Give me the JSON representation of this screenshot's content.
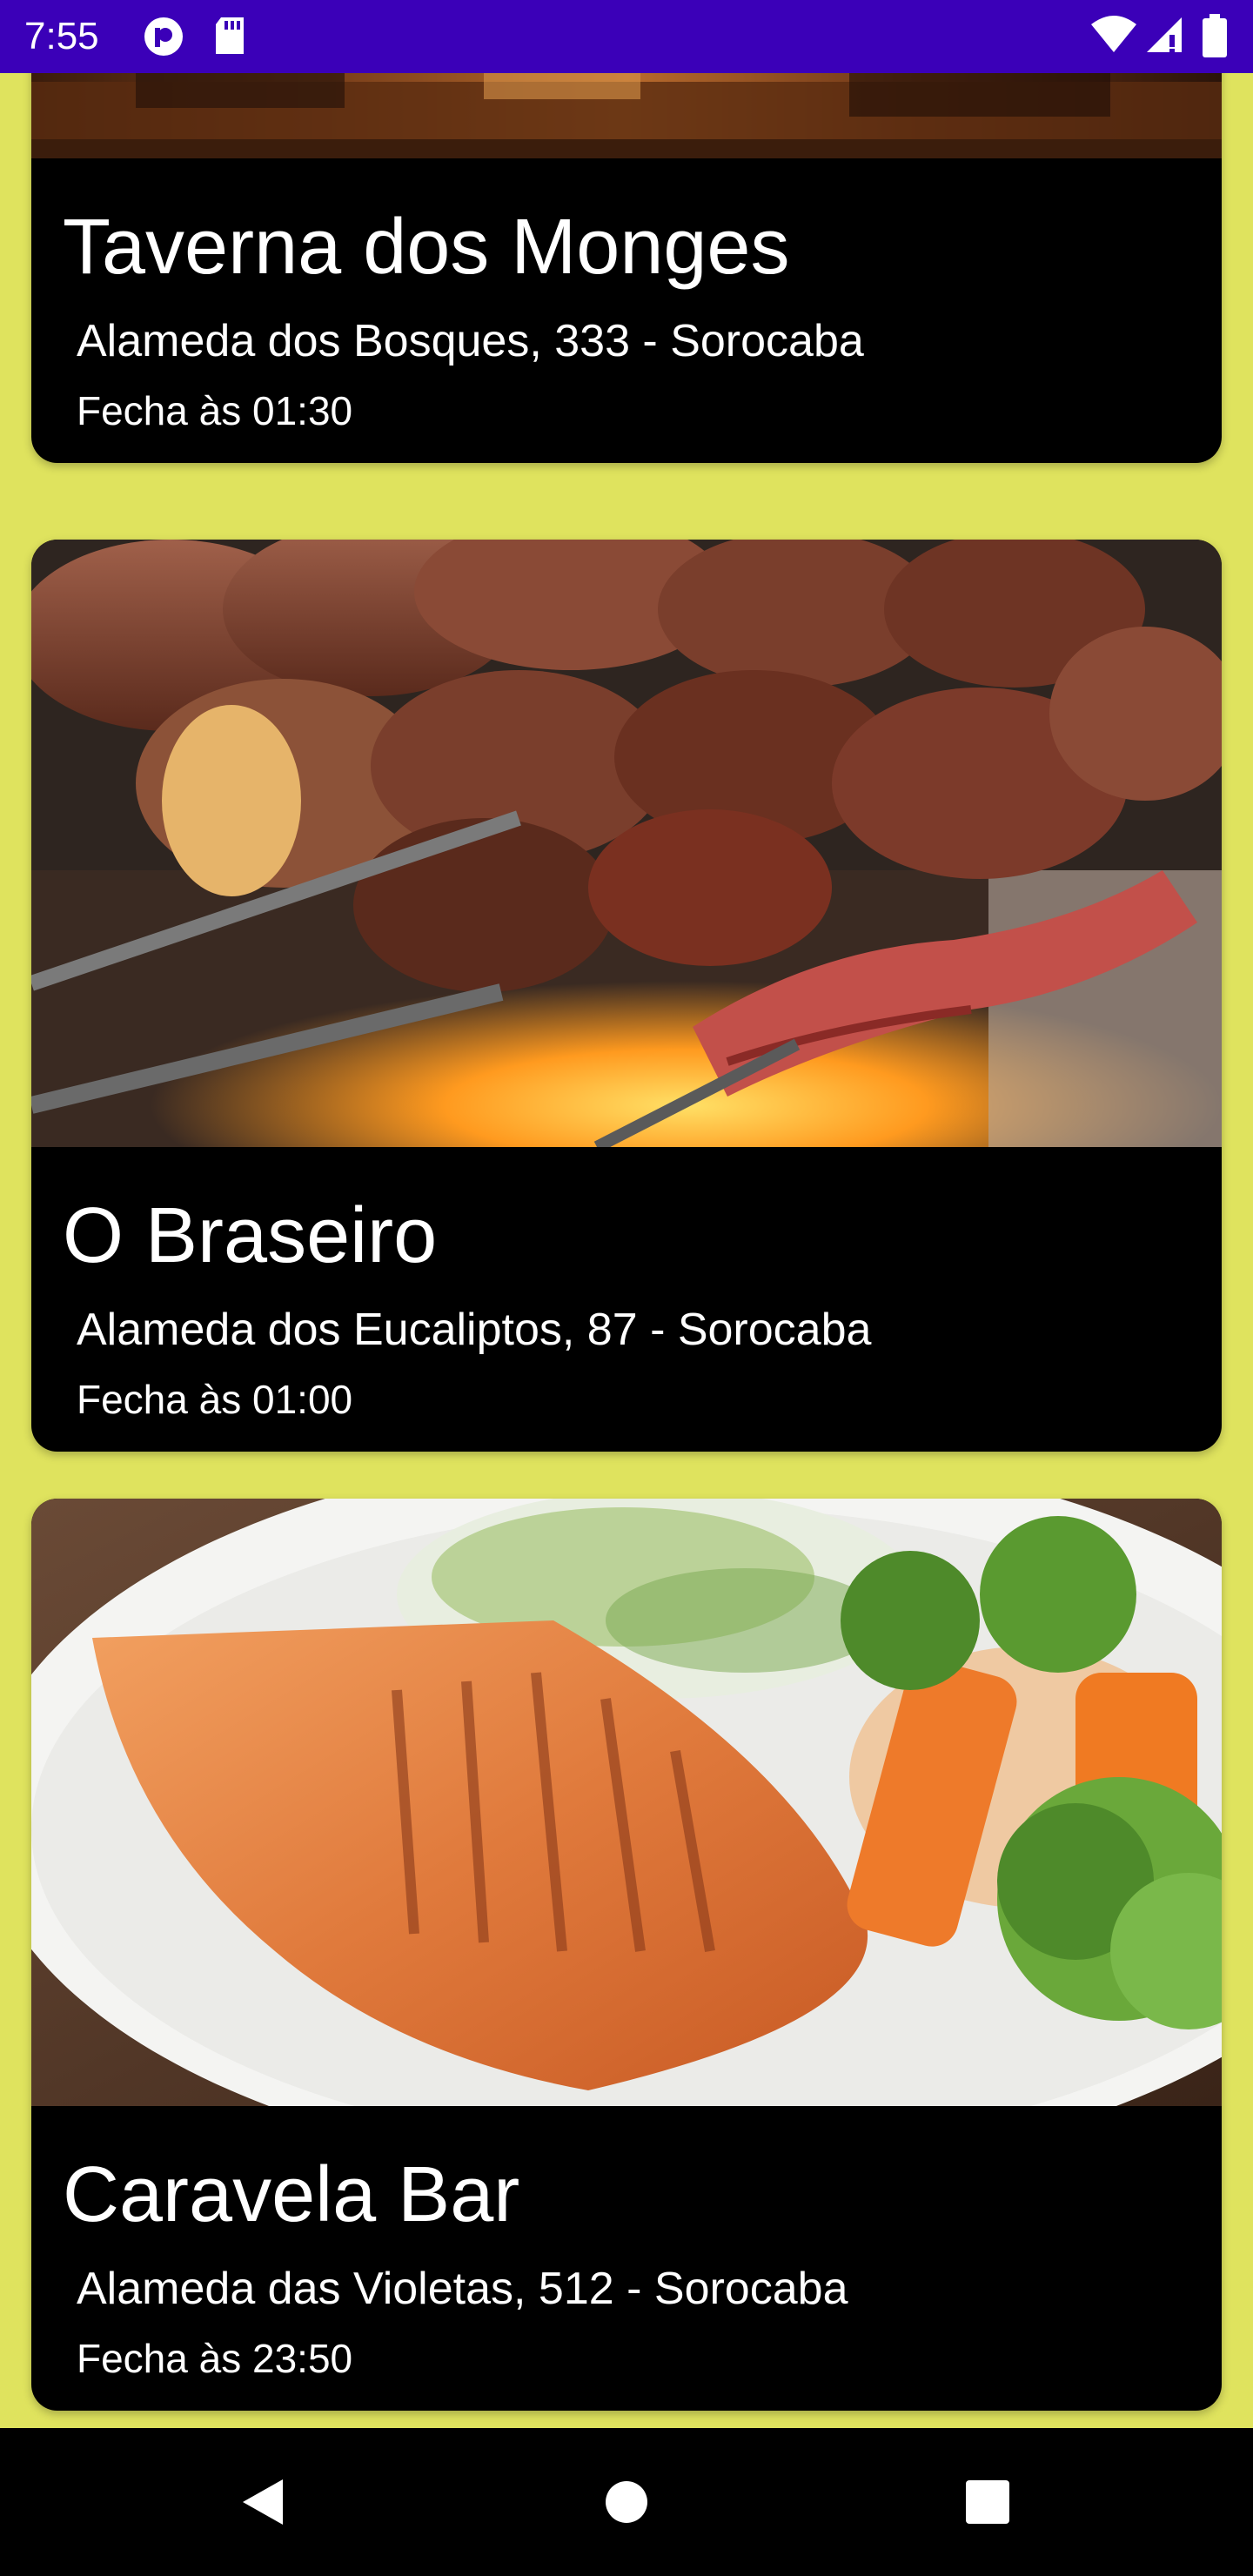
{
  "status_bar": {
    "time": "7:55",
    "icons": [
      "pocket-casts-icon",
      "sd-card-icon",
      "wifi-icon",
      "signal-icon",
      "battery-icon"
    ]
  },
  "restaurants": [
    {
      "name": "Taverna dos Monges",
      "address": "Alameda dos Bosques, 333 - Sorocaba",
      "hours": "Fecha às 01:30",
      "image": "tavern-interior-photo"
    },
    {
      "name": "O Braseiro",
      "address": "Alameda dos Eucaliptos, 87 - Sorocaba",
      "hours": "Fecha às 01:00",
      "image": "barbecue-skewers-photo"
    },
    {
      "name": "Caravela Bar",
      "address": "Alameda das Violetas, 512 - Sorocaba",
      "hours": "Fecha às 23:50",
      "image": "grilled-salmon-plate-photo"
    }
  ],
  "nav_bar": {
    "buttons": [
      "back-icon",
      "home-icon",
      "recents-icon"
    ]
  },
  "colors": {
    "status_bar": "#3b00b8",
    "background": "#dfe35e",
    "card": "#000000",
    "nav_bar": "#000000"
  }
}
